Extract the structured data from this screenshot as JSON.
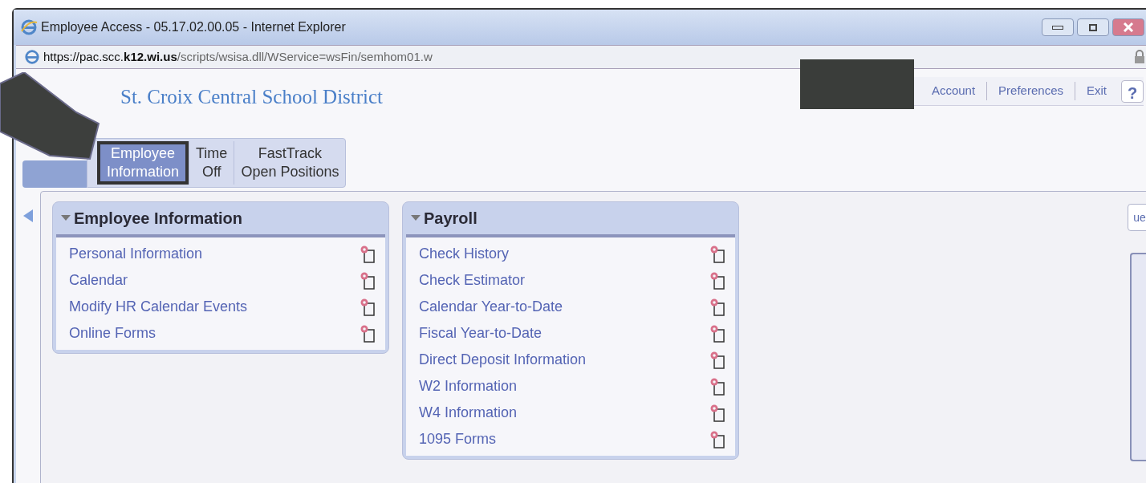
{
  "window": {
    "title": "Employee Access - 05.17.02.00.05 - Internet Explorer"
  },
  "address_bar": {
    "url_prefix": "https://pac.scc.",
    "url_host": "k12.wi.us",
    "url_path": "/scripts/wsisa.dll/WService=wsFin/semhom01.w"
  },
  "header": {
    "title": "St. Croix Central School District",
    "links": [
      "Account",
      "Preferences",
      "Exit"
    ],
    "help": "?"
  },
  "tabs": [
    {
      "label": "Employee Information",
      "selected": true
    },
    {
      "label": "Time Off",
      "selected": false
    },
    {
      "label": "FastTrack Open Positions",
      "selected": false
    }
  ],
  "side_button": "ue",
  "panels": [
    {
      "title": "Employee Information",
      "items": [
        "Personal Information",
        "Calendar",
        "Modify HR Calendar Events",
        "Online Forms"
      ]
    },
    {
      "title": "Payroll",
      "items": [
        "Check History",
        "Check Estimator",
        "Calendar Year-to-Date",
        "Fiscal Year-to-Date",
        "Direct Deposit Information",
        "W2 Information",
        "W4 Information",
        "1095 Forms"
      ]
    }
  ]
}
